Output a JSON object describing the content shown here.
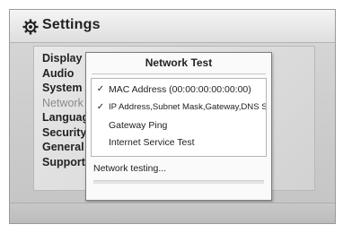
{
  "header": {
    "title": "Settings",
    "icon": "gear-icon"
  },
  "menu": {
    "items": [
      {
        "label": "Display"
      },
      {
        "label": "Audio"
      },
      {
        "label": "System"
      },
      {
        "label": "Network"
      },
      {
        "label": "Language"
      },
      {
        "label": "Security"
      },
      {
        "label": "General"
      },
      {
        "label": "Support"
      }
    ],
    "selected": "Network"
  },
  "dialog": {
    "title": "Network Test",
    "options": [
      {
        "checked": true,
        "check": "✓",
        "label": "MAC Address (00:00:00:00:00:00)"
      },
      {
        "checked": true,
        "check": "✓",
        "label": "IP Address,Subnet Mask,Gateway,DNS Server"
      },
      {
        "checked": false,
        "check": "",
        "label": "Gateway Ping"
      },
      {
        "checked": false,
        "check": "",
        "label": "Internet Service Test"
      }
    ],
    "status": "Network testing...",
    "progress": 0
  }
}
